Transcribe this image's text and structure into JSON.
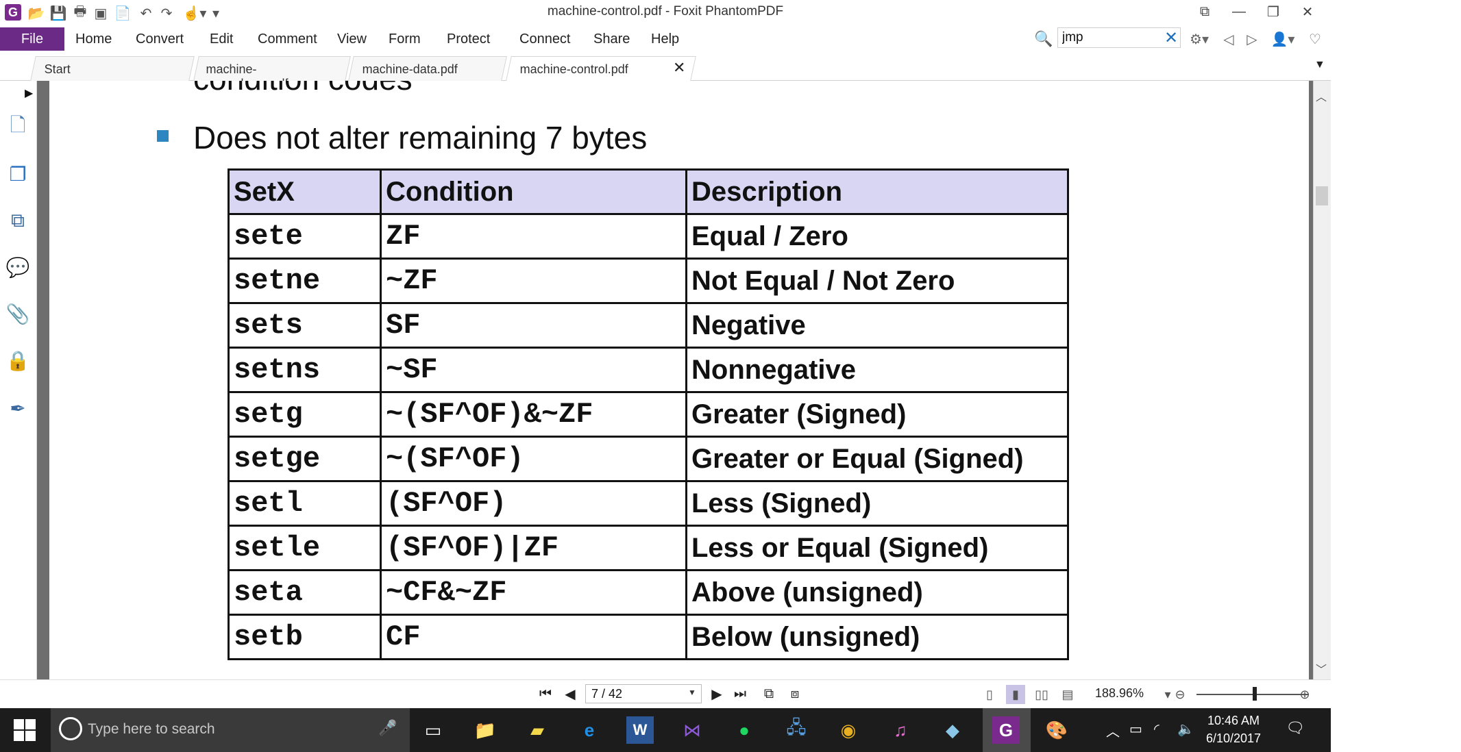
{
  "window": {
    "title": "machine-control.pdf - Foxit PhantomPDF",
    "controls": [
      "⧉",
      "—",
      "❐",
      "✕"
    ]
  },
  "menu": {
    "file": "File",
    "items": [
      "Home",
      "Convert",
      "Edit",
      "Comment",
      "View",
      "Form",
      "Protect",
      "Connect",
      "Share",
      "Help"
    ]
  },
  "search": {
    "value": "jmp",
    "placeholder": ""
  },
  "tabs": [
    {
      "label": "Start"
    },
    {
      "label": "machine-procedures.pdf"
    },
    {
      "label": "machine-data.pdf"
    },
    {
      "label": "machine-control.pdf",
      "active": true
    }
  ],
  "document": {
    "cut_heading": "condition codes",
    "bullet": "Does not alter remaining 7 bytes",
    "table": {
      "headers": [
        "SetX",
        "Condition",
        "Description"
      ],
      "rows": [
        [
          "sete",
          "ZF",
          "Equal / Zero"
        ],
        [
          "setne",
          "~ZF",
          "Not Equal / Not Zero"
        ],
        [
          "sets",
          "SF",
          "Negative"
        ],
        [
          "setns",
          "~SF",
          "Nonnegative"
        ],
        [
          "setg",
          "~(SF^OF)&~ZF",
          "Greater (Signed)"
        ],
        [
          "setge",
          "~(SF^OF)",
          "Greater or Equal (Signed)"
        ],
        [
          "setl",
          "(SF^OF)",
          "Less (Signed)"
        ],
        [
          "setle",
          "(SF^OF)|ZF",
          "Less or Equal (Signed)"
        ],
        [
          "seta",
          "~CF&~ZF",
          "Above (unsigned)"
        ],
        [
          "setb",
          "CF",
          "Below (unsigned)"
        ]
      ]
    }
  },
  "statusbar": {
    "page": "7 / 42",
    "zoom": "188.96%"
  },
  "taskbar": {
    "search_placeholder": "Type here to search",
    "time": "10:46 AM",
    "date": "6/10/2017"
  },
  "colors": {
    "file_button": "#6b2a85",
    "table_header_bg": "#d8d6f2",
    "bullet": "#2e86c1",
    "taskbar": "#1c1c1c"
  }
}
